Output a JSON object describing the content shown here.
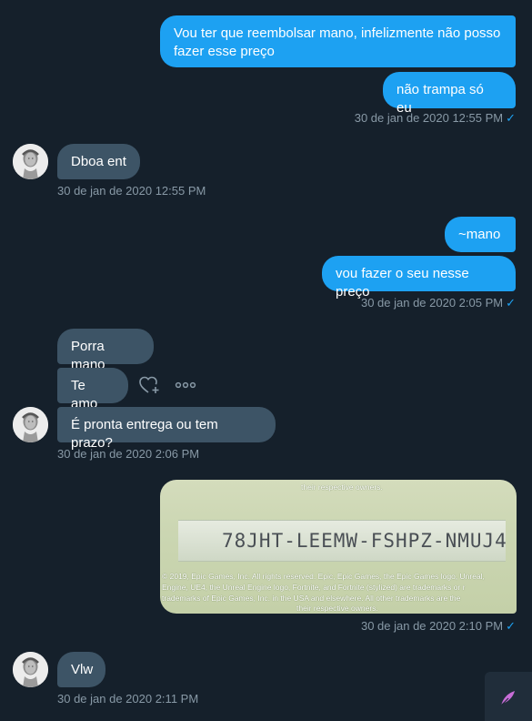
{
  "conversation": {
    "messages": [
      {
        "text": "Vou ter que reembolsar mano, infelizmente não posso fazer esse preço"
      },
      {
        "text": "não trampa só eu"
      },
      {
        "text": "Dboa ent"
      },
      {
        "text": "~mano"
      },
      {
        "text": "vou fazer o seu nesse preço"
      },
      {
        "text": "Porra mano"
      },
      {
        "text": "Te amo"
      },
      {
        "text": "É pronta entrega ou tem prazo?"
      },
      {
        "text": "Vlw"
      }
    ],
    "timestamps": [
      "30 de jan de 2020 12:55 PM",
      "30 de jan de 2020 12:55 PM",
      "30 de jan de 2020 2:05 PM",
      "30 de jan de 2020 2:06 PM",
      "30 de jan de 2020 2:10 PM",
      "30 de jan de 2020 2:11 PM"
    ],
    "read_check": "✓",
    "image": {
      "top_text": "their respective owners.",
      "code": "78JHT-LEEMW-FSHPZ-NMUJ4",
      "legal_lines": [
        "© 2019, Epic Games, Inc. All rights reserved. Epic, Epic Games, the Epic Games logo, Unreal,",
        "Engine, UE4, the Unreal Engine logo, Fortnite, and Fortnite (stylized) are trademarks or r",
        "trademarks of Epic Games, Inc. in the USA and elsewhere. All other trademarks are the",
        "their respective owners."
      ]
    }
  },
  "icons": {
    "like": "heart-plus-icon",
    "more": "more-icon",
    "corner": "feather-icon"
  },
  "colors": {
    "background": "#15202b",
    "outgoing_bubble": "#1da1f2",
    "incoming_bubble": "#3d5466",
    "timestamp": "#8899a6"
  }
}
